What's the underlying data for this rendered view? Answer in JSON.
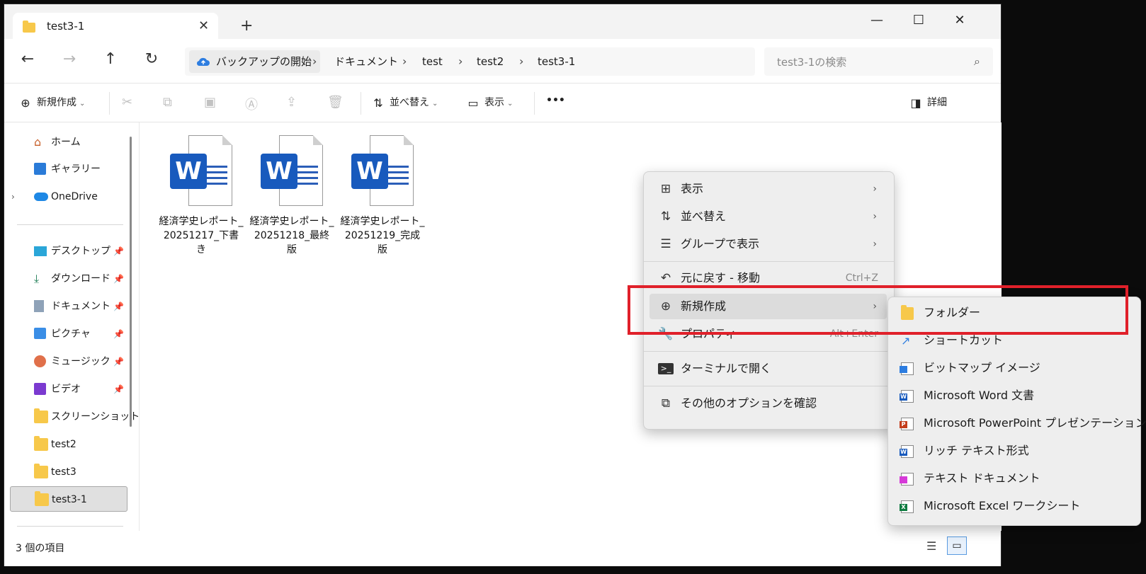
{
  "window": {
    "tab_title": "test3-1",
    "close_tab": "✕",
    "new_tab": "+",
    "minimize": "—",
    "maximize": "☐",
    "close": "✕"
  },
  "address": {
    "root": "バックアップの開始",
    "crumbs": [
      "ドキュメント",
      "test",
      "test2",
      "test3-1"
    ],
    "search_placeholder": "test3-1の検索"
  },
  "toolbar": {
    "new": "新規作成",
    "sort": "並べ替え",
    "view": "表示",
    "more": "•••",
    "details": "詳細"
  },
  "sidebar": {
    "home": "ホーム",
    "gallery": "ギャラリー",
    "onedrive": "OneDrive",
    "desktop": "デスクトップ",
    "downloads": "ダウンロード",
    "documents": "ドキュメント",
    "pictures": "ピクチャ",
    "music": "ミュージック",
    "videos": "ビデオ",
    "screenshots": "スクリーンショット",
    "test2": "test2",
    "test3": "test3",
    "test3_1": "test3-1"
  },
  "files": [
    {
      "name": "経済学史レポート_20251217_下書き"
    },
    {
      "name": "経済学史レポート_20251218_最終版"
    },
    {
      "name": "経済学史レポート_20251219_完成版"
    }
  ],
  "status": {
    "count": "3 個の項目"
  },
  "context_menu": {
    "view": "表示",
    "sort": "並べ替え",
    "group": "グループで表示",
    "undo": "元に戻す - 移動",
    "undo_shortcut": "Ctrl+Z",
    "new": "新規作成",
    "properties": "プロパティ",
    "properties_shortcut": "Alt+Enter",
    "terminal": "ターミナルで開く",
    "more_options": "その他のオプションを確認"
  },
  "submenu": {
    "folder": "フォルダー",
    "shortcut": "ショートカット",
    "bitmap": "ビットマップ イメージ",
    "word": "Microsoft Word 文書",
    "powerpoint": "Microsoft PowerPoint プレゼンテーション",
    "rtf": "リッチ テキスト形式",
    "text": "テキスト ドキュメント",
    "excel": "Microsoft Excel ワークシート"
  }
}
